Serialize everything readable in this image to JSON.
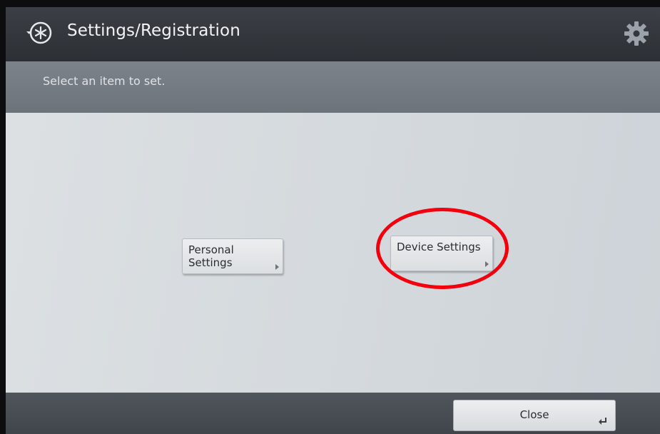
{
  "header": {
    "title": "Settings/Registration",
    "app_icon": "settings-registration-icon",
    "right_icon": "gear-icon"
  },
  "instruction": "Select an item to set.",
  "items": [
    {
      "label": "Personal\nSettings",
      "icon": "arrow-right-icon"
    },
    {
      "label": "Device Settings",
      "icon": "arrow-right-icon"
    }
  ],
  "annotation": {
    "highlight_color": "#f2000d",
    "highlighted_item": "Device Settings"
  },
  "footer": {
    "close_label": "Close",
    "close_icon": "return-icon"
  }
}
